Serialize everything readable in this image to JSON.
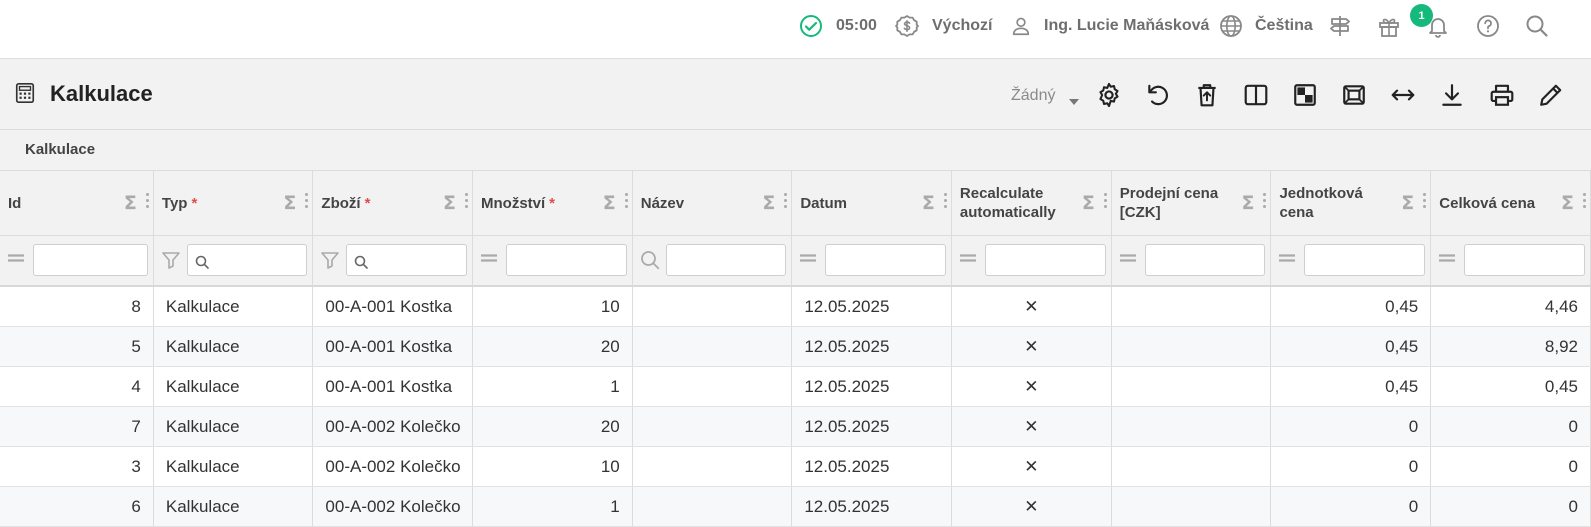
{
  "topbar": {
    "timer": "05:00",
    "currency_profile": "Výchozí",
    "user_name": "Ing. Lucie Maňásková",
    "language": "Čeština",
    "gift_badge": "1"
  },
  "header": {
    "title": "Kalkulace",
    "view_selector": "Žádný"
  },
  "section": {
    "label": "Kalkulace"
  },
  "table": {
    "columns": [
      {
        "label": "Id",
        "required": false
      },
      {
        "label": "Typ",
        "required": true
      },
      {
        "label": "Zboží",
        "required": true
      },
      {
        "label": "Množství",
        "required": true
      },
      {
        "label": "Název",
        "required": false
      },
      {
        "label": "Datum",
        "required": false
      },
      {
        "label": "Recalculate automatically",
        "required": false
      },
      {
        "label": "Prodejní cena [CZK]",
        "required": false
      },
      {
        "label": "Jednotková cena",
        "required": false
      },
      {
        "label": "Celková cena",
        "required": false
      }
    ],
    "required_marker": "*",
    "rows": [
      {
        "id": "8",
        "type": "Kalkulace",
        "product": "00-A-001 Kostka",
        "quantity": "10",
        "name": "",
        "date": "12.05.2025",
        "recalc": "✕",
        "sale_price": "",
        "unit_price": "0,45",
        "total_price": "4,46"
      },
      {
        "id": "5",
        "type": "Kalkulace",
        "product": "00-A-001 Kostka",
        "quantity": "20",
        "name": "",
        "date": "12.05.2025",
        "recalc": "✕",
        "sale_price": "",
        "unit_price": "0,45",
        "total_price": "8,92"
      },
      {
        "id": "4",
        "type": "Kalkulace",
        "product": "00-A-001 Kostka",
        "quantity": "1",
        "name": "",
        "date": "12.05.2025",
        "recalc": "✕",
        "sale_price": "",
        "unit_price": "0,45",
        "total_price": "0,45"
      },
      {
        "id": "7",
        "type": "Kalkulace",
        "product": "00-A-002 Kolečko",
        "quantity": "20",
        "name": "",
        "date": "12.05.2025",
        "recalc": "✕",
        "sale_price": "",
        "unit_price": "0",
        "total_price": "0"
      },
      {
        "id": "3",
        "type": "Kalkulace",
        "product": "00-A-002 Kolečko",
        "quantity": "10",
        "name": "",
        "date": "12.05.2025",
        "recalc": "✕",
        "sale_price": "",
        "unit_price": "0",
        "total_price": "0"
      },
      {
        "id": "6",
        "type": "Kalkulace",
        "product": "00-A-002 Kolečko",
        "quantity": "1",
        "name": "",
        "date": "12.05.2025",
        "recalc": "✕",
        "sale_price": "",
        "unit_price": "0",
        "total_price": "0"
      }
    ]
  },
  "colors": {
    "link": "#4a5ed6",
    "required": "#e14b4b",
    "badge": "#16b97c",
    "status_ok": "#16b97c",
    "header_bg": "#f2f2f2"
  },
  "icons": {
    "topbar": [
      "check-circle-icon",
      "currency-icon",
      "user-icon",
      "globe-icon",
      "signpost-icon",
      "gift-icon",
      "bell-icon",
      "help-icon",
      "search-icon"
    ],
    "toolbar": [
      "settings-icon",
      "undo-icon",
      "delete-icon",
      "split-view-icon",
      "checker-icon",
      "fit-screen-icon",
      "expand-width-icon",
      "download-icon",
      "print-icon",
      "edit-icon"
    ]
  }
}
